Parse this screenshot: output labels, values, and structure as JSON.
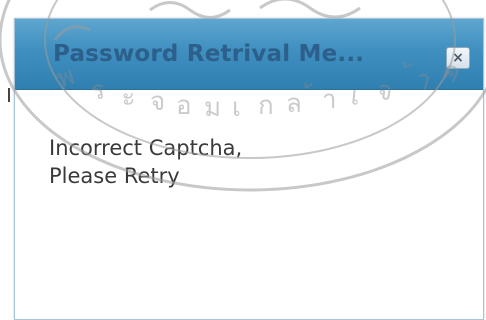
{
  "dialog": {
    "title": "Password Retrival Me...",
    "close_glyph": "×",
    "message_line1": "Incorrect Captcha,",
    "message_line2": "Please Retry"
  },
  "watermark": {
    "text": "มหาวิทยาลัยเทคโนโลยีพระจอมเกล้าเจ้าคุณทหารลาดกระบัง"
  },
  "colors": {
    "titlebar": "#3f8fc0",
    "title_text": "#2c5f8a",
    "message_text": "#3a3a3a"
  },
  "icons": {
    "close": "close-icon"
  }
}
